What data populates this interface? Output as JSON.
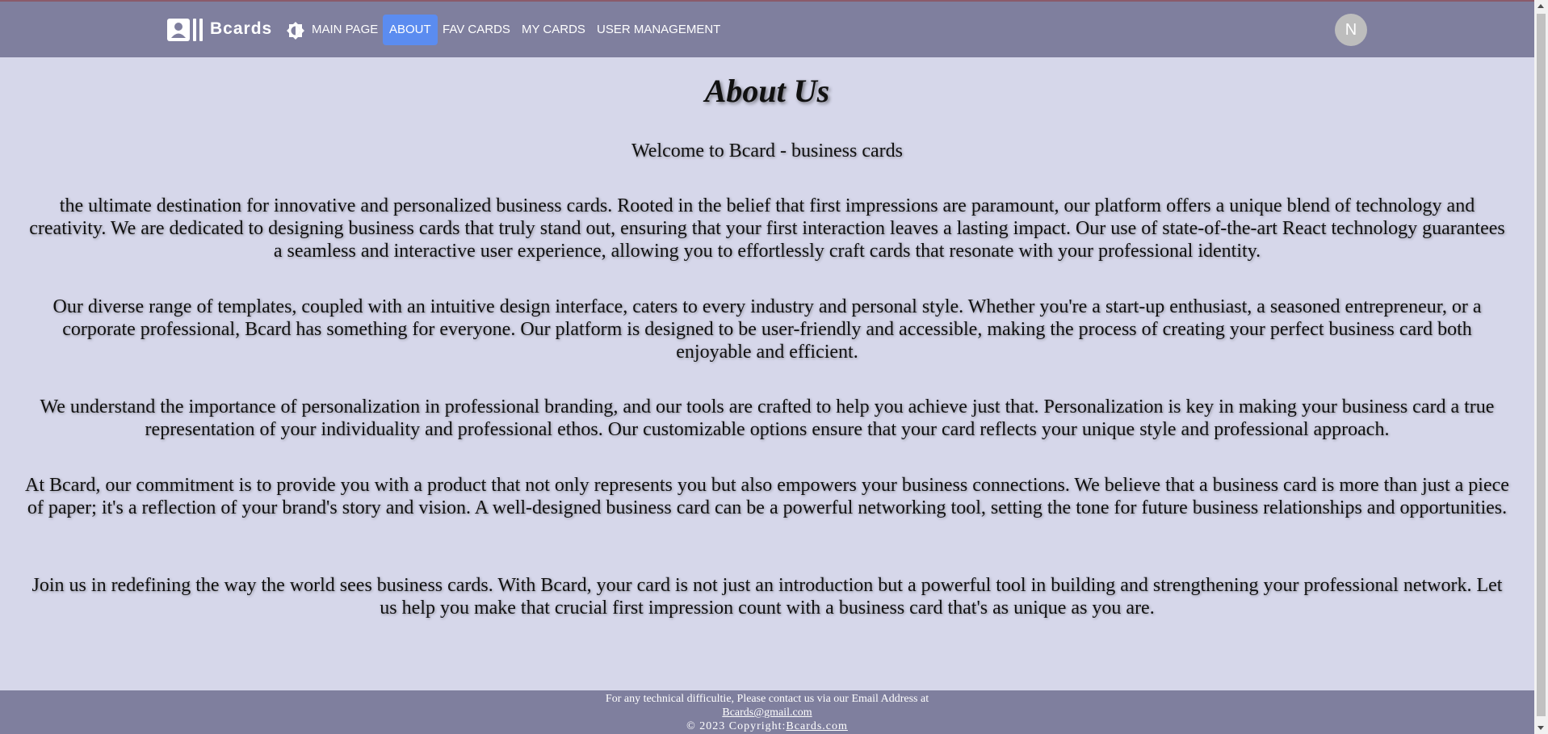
{
  "navbar": {
    "brand": "Bcards",
    "brand_icon": "contact-card-icon",
    "theme_icon": "brightness-toggle-icon",
    "items": [
      {
        "label": "MAIN PAGE",
        "active": false
      },
      {
        "label": "ABOUT",
        "active": true
      },
      {
        "label": "FAV CARDS",
        "active": false
      },
      {
        "label": "MY CARDS",
        "active": false
      },
      {
        "label": "USER MANAGEMENT",
        "active": false
      }
    ],
    "avatar_letter": "N"
  },
  "main": {
    "title": "About Us",
    "welcome": "Welcome to Bcard - business cards",
    "paragraphs": [
      "the ultimate destination for innovative and personalized business cards. Rooted in the belief that first impressions are paramount, our platform offers a unique blend of technology and creativity. We are dedicated to designing business cards that truly stand out, ensuring that your first interaction leaves a lasting impact. Our use of state-of-the-art React technology guarantees a seamless and interactive user experience, allowing you to effortlessly craft cards that resonate with your professional identity.",
      "Our diverse range of templates, coupled with an intuitive design interface, caters to every industry and personal style. Whether you're a start-up enthusiast, a seasoned entrepreneur, or a corporate professional, Bcard has something for everyone. Our platform is designed to be user-friendly and accessible, making the process of creating your perfect business card both enjoyable and efficient.",
      "We understand the importance of personalization in professional branding, and our tools are crafted to help you achieve just that. Personalization is key in making your business card a true representation of your individuality and professional ethos. Our customizable options ensure that your card reflects your unique style and professional approach.",
      "At Bcard, our commitment is to provide you with a product that not only represents you but also empowers your business connections. We believe that a business card is more than just a piece of paper; it's a reflection of your brand's story and vision. A well-designed business card can be a powerful networking tool, setting the tone for future business relationships and opportunities.",
      "Join us in redefining the way the world sees business cards. With Bcard, your card is not just an introduction but a powerful tool in building and strengthening your professional network. Let us help you make that crucial first impression count with a business card that's as unique as you are."
    ]
  },
  "footer": {
    "contact_text": "For any technical difficultie, Please contact us via our Email Address at",
    "email": "Bcards@gmail.com",
    "copyright_prefix": "© 2023 Copyright:",
    "copyright_link": "Bcards.com"
  },
  "colors": {
    "navbar_bg": "#7f7f9e",
    "page_bg": "#d6d7ea",
    "active_tab": "#5b8cf0"
  }
}
